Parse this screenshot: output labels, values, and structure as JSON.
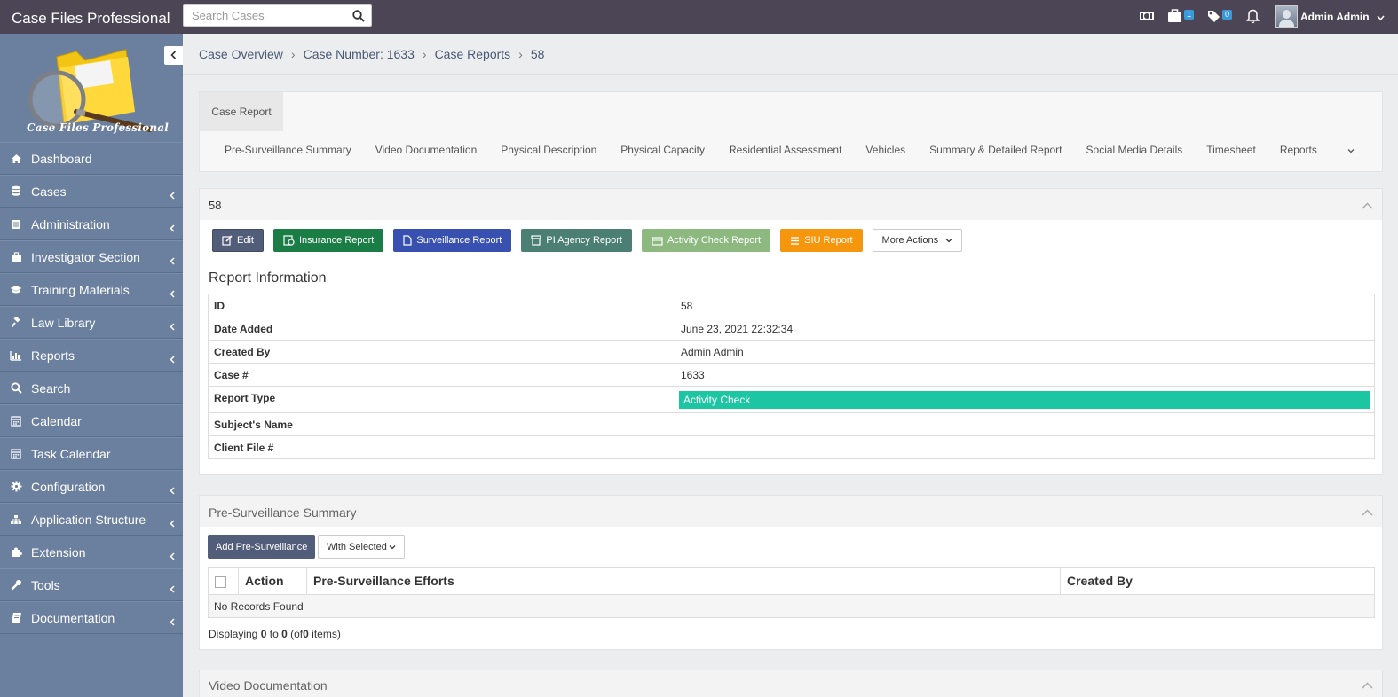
{
  "app": {
    "title": "Case Files Professional",
    "logo_text": "Case Files Professional"
  },
  "topbar": {
    "search_placeholder": "Search Cases",
    "badge_cases": "1",
    "badge_tags": "0",
    "user_name": "Admin Admin"
  },
  "sidebar": {
    "items": [
      {
        "label": "Dashboard",
        "icon": "home-icon",
        "expandable": false
      },
      {
        "label": "Cases",
        "icon": "database-icon",
        "expandable": true
      },
      {
        "label": "Administration",
        "icon": "list-icon",
        "expandable": true
      },
      {
        "label": "Investigator Section",
        "icon": "briefcase-icon",
        "expandable": true
      },
      {
        "label": "Training Materials",
        "icon": "graduation-cap-icon",
        "expandable": true
      },
      {
        "label": "Law Library",
        "icon": "gavel-icon",
        "expandable": true
      },
      {
        "label": "Reports",
        "icon": "bar-chart-icon",
        "expandable": true
      },
      {
        "label": "Search",
        "icon": "search-icon",
        "expandable": false
      },
      {
        "label": "Calendar",
        "icon": "calendar-icon",
        "expandable": false
      },
      {
        "label": "Task Calendar",
        "icon": "calendar-icon",
        "expandable": false
      },
      {
        "label": "Configuration",
        "icon": "gear-icon",
        "expandable": true
      },
      {
        "label": "Application Structure",
        "icon": "sitemap-icon",
        "expandable": true
      },
      {
        "label": "Extension",
        "icon": "puzzle-icon",
        "expandable": true
      },
      {
        "label": "Tools",
        "icon": "wrench-icon",
        "expandable": true
      },
      {
        "label": "Documentation",
        "icon": "book-icon",
        "expandable": true
      }
    ]
  },
  "breadcrumb": [
    "Case Overview",
    "Case Number: 1633",
    "Case Reports",
    "58"
  ],
  "tabs": {
    "main": "Case Report",
    "sub": [
      "Pre-Surveillance Summary",
      "Video Documentation",
      "Physical Description",
      "Physical Capacity",
      "Residential Assessment",
      "Vehicles",
      "Summary & Detailed Report",
      "Social Media Details",
      "Timesheet",
      "Reports"
    ]
  },
  "report": {
    "panel_title": "58",
    "buttons": {
      "edit": "Edit",
      "insurance": "Insurance Report",
      "surveillance": "Surveillance Report",
      "pi_agency": "PI Agency Report",
      "activity_check": "Activity Check Report",
      "siu": "SIU Report",
      "more": "More Actions"
    },
    "section_title": "Report Information",
    "rows": [
      {
        "label": "ID",
        "value": "58"
      },
      {
        "label": "Date Added",
        "value": "June 23, 2021 22:32:34"
      },
      {
        "label": "Created By",
        "value": "Admin Admin"
      },
      {
        "label": "Case #",
        "value": "1633"
      },
      {
        "label": "Report Type",
        "value": "Activity Check"
      },
      {
        "label": "Subject's Name",
        "value": ""
      },
      {
        "label": "Client File #",
        "value": ""
      }
    ]
  },
  "pre_surveillance": {
    "title": "Pre-Surveillance Summary",
    "add_button": "Add Pre-Surveillance",
    "with_selected": "With Selected",
    "columns": [
      "Action",
      "Pre-Surveillance Efforts",
      "Created By"
    ],
    "empty": "No Records Found",
    "display": {
      "prefix": "Displaying",
      "from": "0",
      "to_word": "to",
      "to": "0",
      "of_open": "(of",
      "total": "0",
      "items": "items)"
    }
  },
  "video": {
    "title": "Video Documentation"
  },
  "colors": {
    "topbar": "#4c4555",
    "sidebar": "#6b7f9e",
    "accent_badge": "#1cc6a2",
    "btn_insurance": "#1a7d45",
    "btn_surveillance": "#3850b0",
    "btn_siu": "#f6960d"
  }
}
